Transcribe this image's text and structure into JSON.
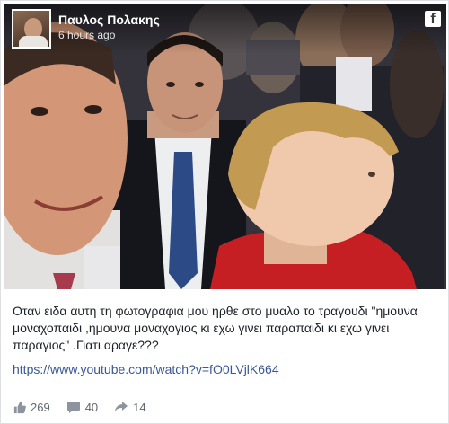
{
  "post": {
    "author": "Παυλος Πολακης",
    "time": "6 hours ago",
    "platform_icon": "facebook-icon",
    "caption": "Οταν ειδα αυτη τη φωτογραφια μου ηρθε στο μυαλο το τραγουδι \"ημουνα μοναχοπαιδι ,ημουνα μοναχογιος κι εχω γινει παραπαιδι κι εχω γινει παραγιος\" .Γιατι αραγε???",
    "link": "https://www.youtube.com/watch?v=fO0LVjlK664"
  },
  "stats": {
    "likes": "269",
    "comments": "40",
    "shares": "14"
  },
  "icons": {
    "like": "thumbs-up-icon",
    "comment": "comment-icon",
    "share": "share-icon"
  },
  "colors": {
    "link": "#385898",
    "text": "#1d2129",
    "meta": "#616770"
  }
}
